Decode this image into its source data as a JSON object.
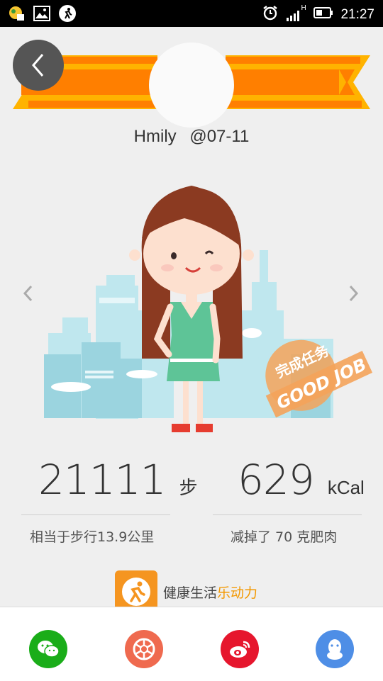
{
  "status_bar": {
    "time": "21:27",
    "network": "H",
    "left_icons": [
      "notification-app-icon",
      "gallery-icon",
      "running-icon"
    ],
    "right_icons": [
      "alarm-icon",
      "signal-icon",
      "battery-icon"
    ]
  },
  "header": {
    "user_name": "Hmily",
    "date": "@07-11",
    "banner_color": "#ff7f00",
    "banner_stripe_color": "#ffb300"
  },
  "stats": {
    "steps": {
      "value": "21111",
      "unit": "步",
      "description": "相当于步行13.9公里"
    },
    "calories": {
      "value": "629",
      "unit": "kCal",
      "description": "减掉了 70 克肥肉"
    }
  },
  "stamp": {
    "line1": "完成任务",
    "line2": "GOOD JOB"
  },
  "brand": {
    "text_prefix": "健康生活",
    "text_highlight": "乐动力",
    "logo_color": "#f59520"
  },
  "share": [
    {
      "name": "wechat-share-button",
      "icon": "wechat-icon",
      "color": "#1aad19"
    },
    {
      "name": "moments-share-button",
      "icon": "moments-icon",
      "color": "#ef6a4f"
    },
    {
      "name": "weibo-share-button",
      "icon": "weibo-icon",
      "color": "#e6162d"
    },
    {
      "name": "qq-share-button",
      "icon": "qq-icon",
      "color": "#4e8ee6"
    }
  ]
}
